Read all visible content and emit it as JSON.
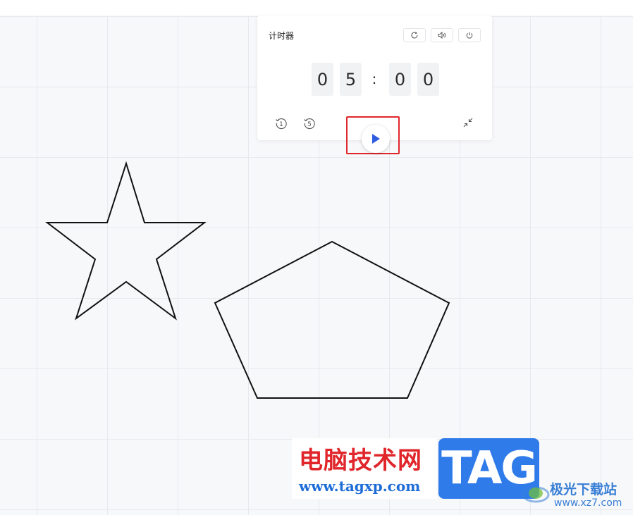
{
  "timer": {
    "title": "计时器",
    "digits": [
      "0",
      "5",
      "0",
      "0"
    ],
    "separator": ":",
    "header_buttons": [
      "reset-icon",
      "volume-icon",
      "power-icon"
    ],
    "footer_buttons": [
      "rewind-1-icon",
      "rewind-5-icon",
      "play-icon",
      "collapse-icon"
    ]
  },
  "canvas": {
    "shapes": [
      "star",
      "pentagon"
    ]
  },
  "watermark": {
    "site_name": "电脑技术网",
    "site_url": "www.tagxp.com",
    "tag_logo": "TAG",
    "right_name": "极光下载站",
    "right_url": "www.xz7.com"
  },
  "colors": {
    "accent_blue": "#2f5ce0",
    "highlight_red": "#e0262b",
    "shape_stroke": "#111111",
    "grid_line": "#e7e9ee"
  }
}
